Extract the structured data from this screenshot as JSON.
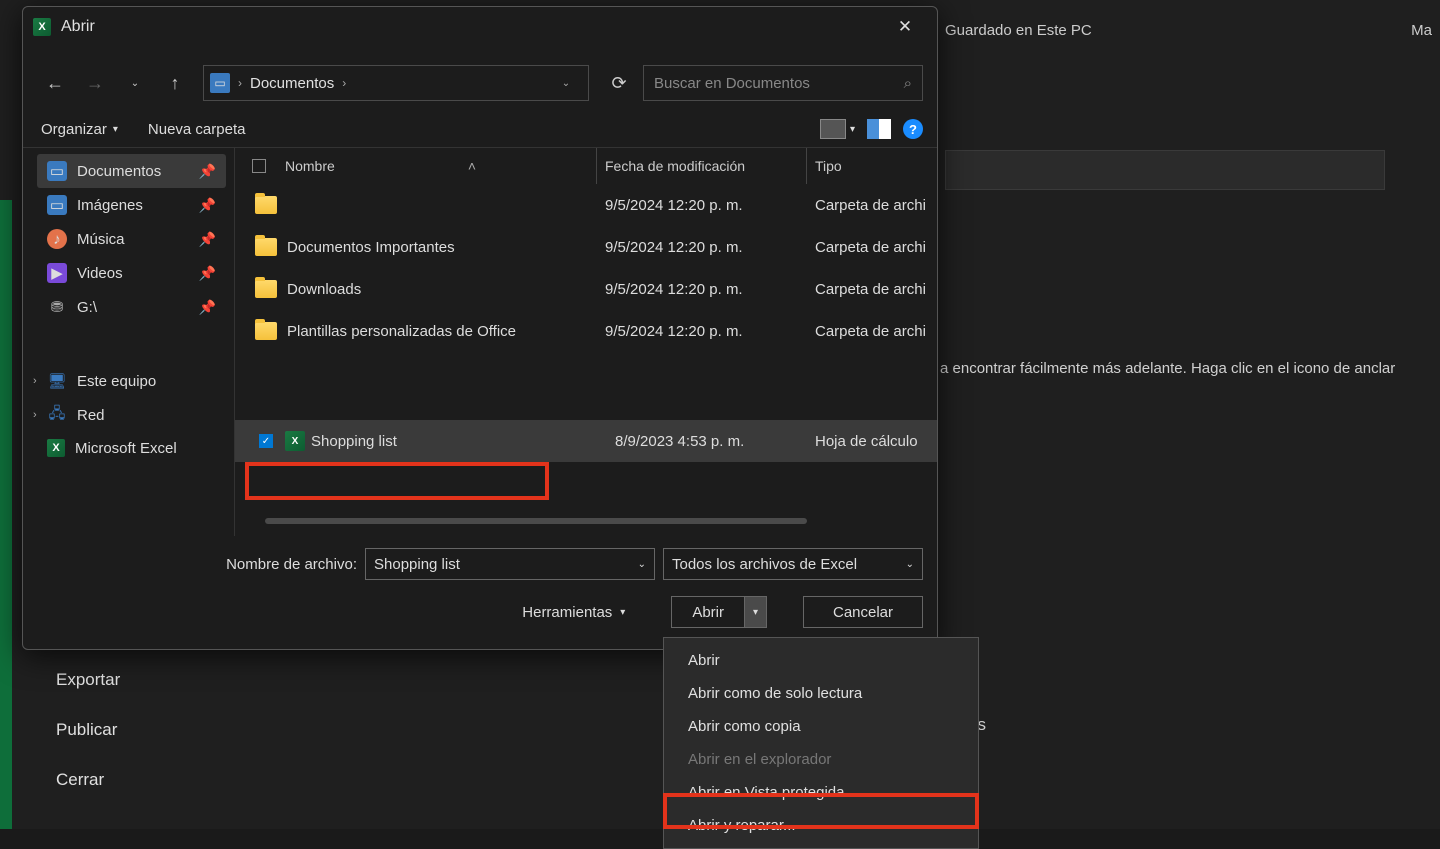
{
  "background": {
    "saved_in": "Guardado en Este PC",
    "truncated_right": "Ma",
    "hint_text": "a encontrar fácilmente más adelante. Haga clic en el icono de anclar",
    "es_fragment": "es",
    "left_menu": {
      "export": "Exportar",
      "publish": "Publicar",
      "close": "Cerrar"
    }
  },
  "dialog": {
    "title": "Abrir",
    "breadcrumb": {
      "folder": "Documentos"
    },
    "search": {
      "placeholder": "Buscar en Documentos"
    },
    "toolbar": {
      "organize": "Organizar",
      "new_folder": "Nueva carpeta"
    },
    "sidebar": {
      "quick": [
        {
          "label": "Documentos",
          "pinned": true,
          "active": true,
          "icon": "doc",
          "color": "#3a7abf"
        },
        {
          "label": "Imágenes",
          "pinned": true,
          "icon": "img",
          "color": "#3a7abf"
        },
        {
          "label": "Música",
          "pinned": true,
          "icon": "music",
          "color": "#e3724a"
        },
        {
          "label": "Videos",
          "pinned": true,
          "icon": "video",
          "color": "#7a4ad9"
        },
        {
          "label": "G:\\",
          "pinned": true,
          "icon": "drive",
          "color": "#888"
        }
      ],
      "tree": [
        {
          "label": "Este equipo",
          "icon": "pc",
          "color": "#3a7abf"
        },
        {
          "label": "Red",
          "icon": "net",
          "color": "#3a7abf"
        },
        {
          "label": "Microsoft Excel",
          "icon": "excel",
          "color": "#1a7a43"
        }
      ]
    },
    "columns": {
      "name": "Nombre",
      "date": "Fecha de modificación",
      "type": "Tipo"
    },
    "files": [
      {
        "name": "",
        "date": "9/5/2024 12:20 p. m.",
        "type": "Carpeta de archi",
        "kind": "folder"
      },
      {
        "name": "Documentos Importantes",
        "date": "9/5/2024 12:20 p. m.",
        "type": "Carpeta de archi",
        "kind": "folder"
      },
      {
        "name": "Downloads",
        "date": "9/5/2024 12:20 p. m.",
        "type": "Carpeta de archi",
        "kind": "folder"
      },
      {
        "name": "Plantillas personalizadas de Office",
        "date": "9/5/2024 12:20 p. m.",
        "type": "Carpeta de archi",
        "kind": "folder"
      }
    ],
    "selected_file": {
      "name": "Shopping list",
      "date": "8/9/2023 4:53 p. m.",
      "type": "Hoja de cálculo"
    },
    "footer": {
      "filename_label": "Nombre de archivo:",
      "filename_value": "Shopping list",
      "filetype_value": "Todos los archivos de Excel",
      "tools": "Herramientas",
      "open": "Abrir",
      "cancel": "Cancelar"
    }
  },
  "dropdown": {
    "items": [
      {
        "label": "Abrir",
        "disabled": false
      },
      {
        "label": "Abrir como de solo lectura",
        "disabled": false
      },
      {
        "label": "Abrir como copia",
        "disabled": false
      },
      {
        "label": "Abrir en el explorador",
        "disabled": true
      },
      {
        "label": "Abrir en Vista protegida",
        "disabled": false
      },
      {
        "label": "Abrir y reparar...",
        "disabled": false
      }
    ]
  }
}
